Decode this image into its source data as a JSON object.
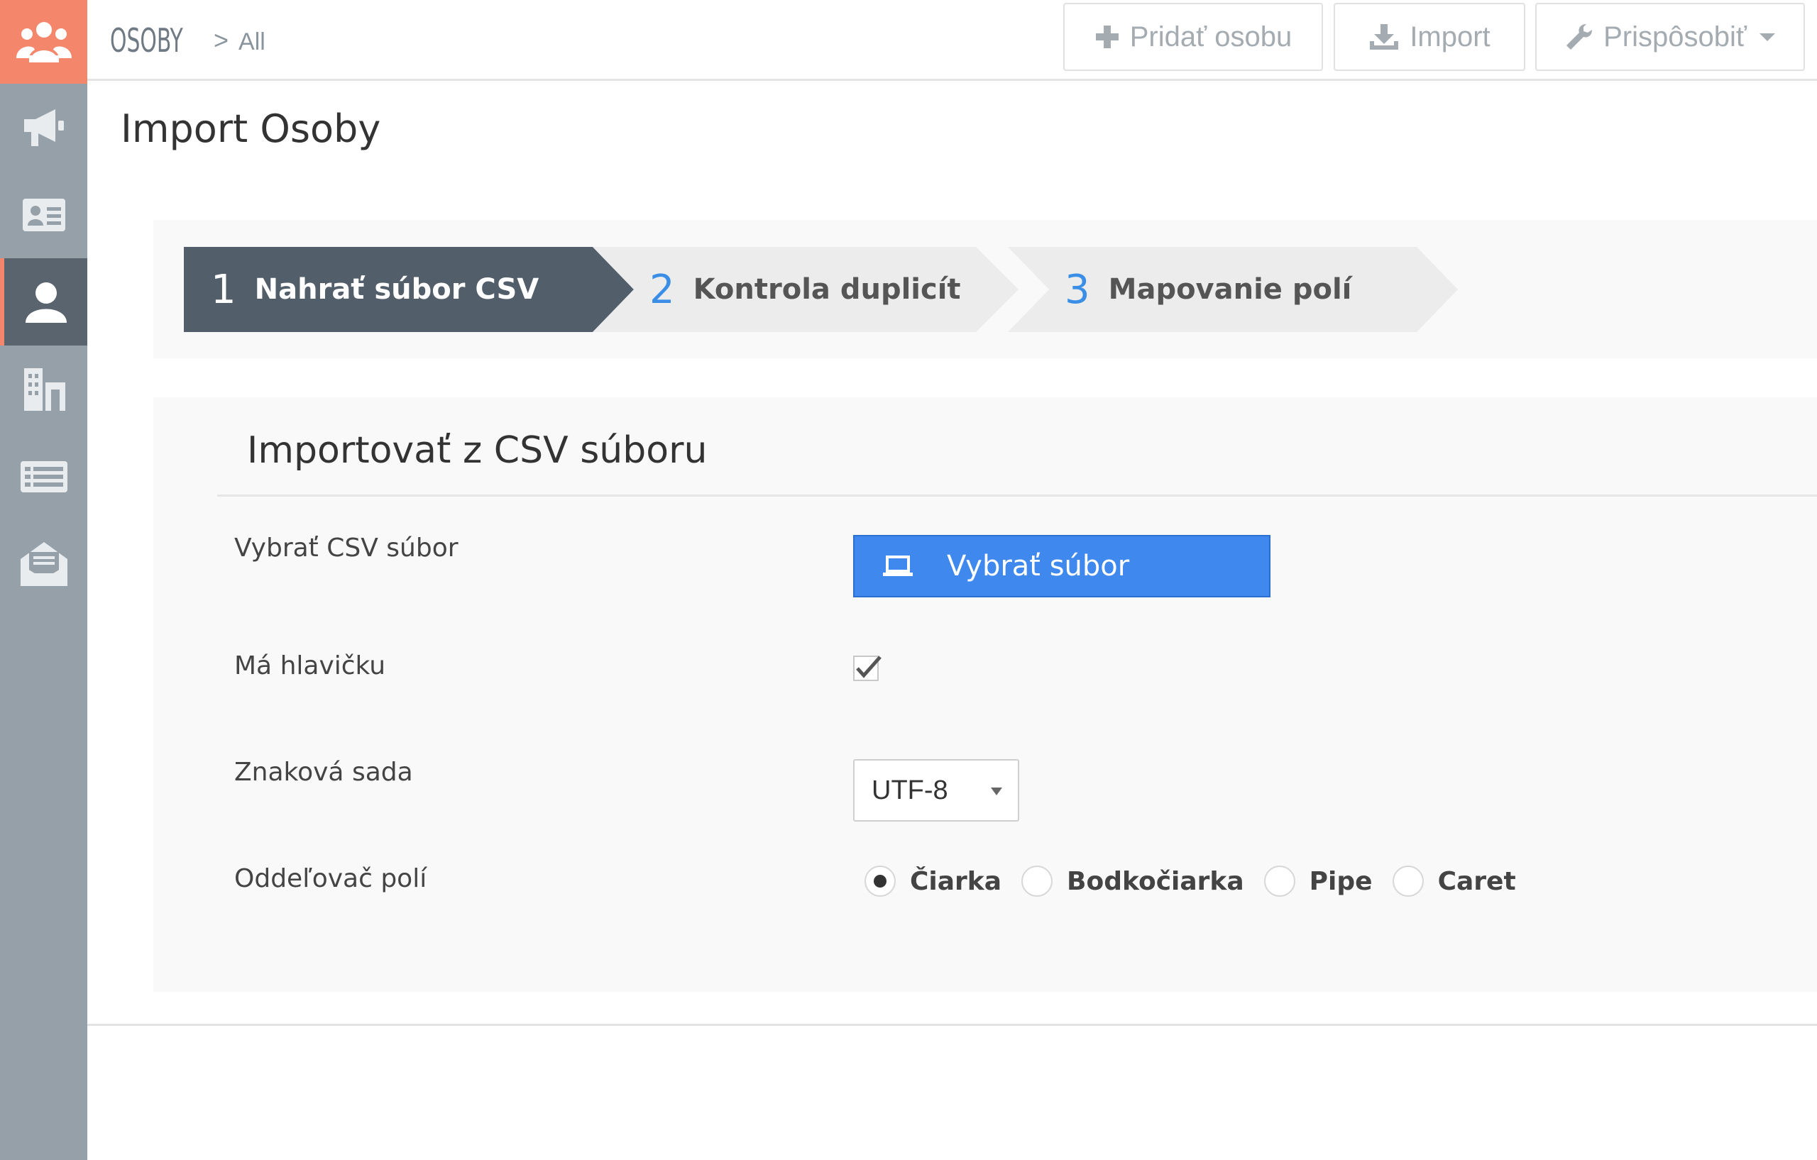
{
  "topbar": {
    "module": "OSOBY",
    "separator": ">",
    "view": "All",
    "buttons": {
      "add": "Pridať osobu",
      "import": "Import",
      "customize": "Prispôsobiť"
    }
  },
  "sidebar": {
    "items": [
      {
        "icon": "users-group-icon"
      },
      {
        "icon": "megaphone-icon"
      },
      {
        "icon": "contact-card-icon"
      },
      {
        "icon": "person-icon",
        "active": true
      },
      {
        "icon": "buildings-icon"
      },
      {
        "icon": "list-icon"
      },
      {
        "icon": "envelope-icon"
      }
    ]
  },
  "page": {
    "title": "Import Osoby"
  },
  "steps": [
    {
      "number": "1",
      "label": "Nahrať súbor CSV",
      "active": true
    },
    {
      "number": "2",
      "label": "Kontrola duplicít",
      "active": false
    },
    {
      "number": "3",
      "label": "Mapovanie polí",
      "active": false
    }
  ],
  "form": {
    "title": "Importovať z CSV súboru",
    "file_label": "Vybrať CSV súbor",
    "file_button": "Vybrať súbor",
    "header_label": "Má hlavičku",
    "header_checked": true,
    "charset_label": "Znaková sada",
    "charset_value": "UTF-8",
    "separator_label": "Oddeľovač polí",
    "separator_options": [
      {
        "label": "Čiarka",
        "selected": true
      },
      {
        "label": "Bodkočiarka",
        "selected": false
      },
      {
        "label": "Pipe",
        "selected": false
      },
      {
        "label": "Caret",
        "selected": false
      }
    ]
  },
  "colors": {
    "accent": "#f4866c",
    "sidebar": "#96a0a9",
    "sidebar_active": "#59646e",
    "step_active": "#525e6a",
    "step_number": "#3a8ee6",
    "primary_button": "#3f88ee"
  }
}
